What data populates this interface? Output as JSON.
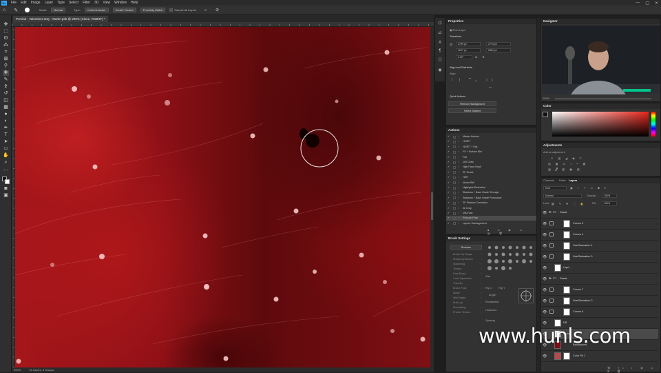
{
  "app": {
    "logo_text": "Ps",
    "menu": [
      "File",
      "Edit",
      "Image",
      "Layer",
      "Type",
      "Select",
      "Filter",
      "3D",
      "View",
      "Window",
      "Help"
    ],
    "window_controls": [
      "—",
      "▢",
      "✕"
    ]
  },
  "options_bar": {
    "mode_label": "Mode:",
    "mode_value": "Normal",
    "type_label": "Type:",
    "type_buttons": [
      "Content-Aware",
      "Create Texture",
      "Proximity Match"
    ],
    "sample_all_layers": "Sample All Layers",
    "angle_value": "0°"
  },
  "document": {
    "tab_title": "Porclab - Valentines Day - Martin.psb @ 200% (Clone, RGB/8*) *",
    "zoom": "200%",
    "status": "16 Layers, 5 Groups",
    "ruler_labels": [
      "3300",
      "3350",
      "3400",
      "3450",
      "3500",
      "3550",
      "3600",
      "3650",
      "3700",
      "3750",
      "3800",
      "3850",
      "3900",
      "3950",
      "4000",
      "4050",
      "4100",
      "4150",
      "4200",
      "4250",
      "4300",
      "4350",
      "4400",
      "4450",
      "4500",
      "4550",
      "4600",
      "4650",
      "4700",
      "4750",
      "4800",
      "4850",
      "4900",
      "4950",
      "5000",
      "5050",
      "5100",
      "5150",
      "5200",
      "5250",
      "5300",
      "5350"
    ]
  },
  "properties": {
    "title": "Properties",
    "layer_kind": "Pixel Layer",
    "transform_title": "Transform",
    "w": "2799 px",
    "x": "2770 px",
    "h": "2227 px",
    "y": "2861 px",
    "angle": "0.00°",
    "align_title": "Align and Distribute",
    "align_sub": "Align:",
    "more": "•••",
    "quick_actions_title": "Quick Actions",
    "remove_bg": "Remove Background",
    "select_subject": "Select Subject"
  },
  "actions": {
    "title": "Actions",
    "items": [
      "Master Autumn",
      "Hi BET",
      "Hi BET + Flat",
      "FS + Surface Blur",
      "Flat",
      "10K Grain",
      "High Pass Small",
      "SF Grade",
      "HDR",
      "Vector BW",
      "Highlights Reduction",
      "Shadows + Base Grade Stronger",
      "Shadows + Base Grade Pronounce",
      "SF Shadow Correction",
      "All Crop",
      "DNA Van",
      "Retouch Prep",
      "Layers / Management"
    ],
    "selected_index": 16
  },
  "brush_settings": {
    "title": "Brush Settings",
    "brushes_button": "Brushes",
    "options": [
      "Brush Tip Shape",
      "Shape Dynamics",
      "Scattering",
      "Texture",
      "Dual Brush",
      "Color Dynamics",
      "Transfer",
      "Brush Pose",
      "Noise",
      "Wet Edges",
      "Build-up",
      "Smoothing",
      "Protect Texture"
    ],
    "size_label": "Size",
    "flip_x": "Flip X",
    "flip_y": "Flip Y",
    "angle_label": "Angle:",
    "roundness_label": "Roundness:",
    "hardness_label": "Hardness",
    "spacing_label": "Spacing"
  },
  "navigator": {
    "title": "Navigator",
    "zoom": "200%"
  },
  "color": {
    "title": "Color",
    "hue_color": "#e8261c"
  },
  "adjustments": {
    "title": "Adjustments",
    "add_label": "Add an adjustment"
  },
  "layers_panel": {
    "tabs": [
      "Channels",
      "Paths",
      "Layers"
    ],
    "active_tab": "Layers",
    "kind_filter": "Kind",
    "blend_mode": "Normal",
    "opacity_label": "Opacity:",
    "opacity_value": "100%",
    "lock_label": "Lock:",
    "fill_label": "Fill:",
    "fill_value": "100%",
    "layers": [
      {
        "name": "Grade",
        "kind": "group"
      },
      {
        "name": "Curves 5",
        "kind": "adjustment"
      },
      {
        "name": "Curves 4",
        "kind": "adjustment"
      },
      {
        "name": "Hue/Saturation 4",
        "kind": "adjustment"
      },
      {
        "name": "Hue/Saturation 3",
        "kind": "adjustment"
      },
      {
        "name": "Liqui...",
        "kind": "pixel"
      },
      {
        "name": "Grade",
        "kind": "group"
      },
      {
        "name": "Curves 7",
        "kind": "adjustment"
      },
      {
        "name": "Hue/Saturation 3",
        "kind": "adjustment"
      },
      {
        "name": "Curves 6",
        "kind": "adjustment"
      },
      {
        "name": "DB",
        "kind": "pixel"
      },
      {
        "name": "Clone",
        "kind": "pixel"
      },
      {
        "name": "Background",
        "kind": "pixel"
      },
      {
        "name": "Color Fill 1",
        "kind": "fill"
      }
    ],
    "selected_index": 11
  },
  "watermark": "www.hunls.com"
}
